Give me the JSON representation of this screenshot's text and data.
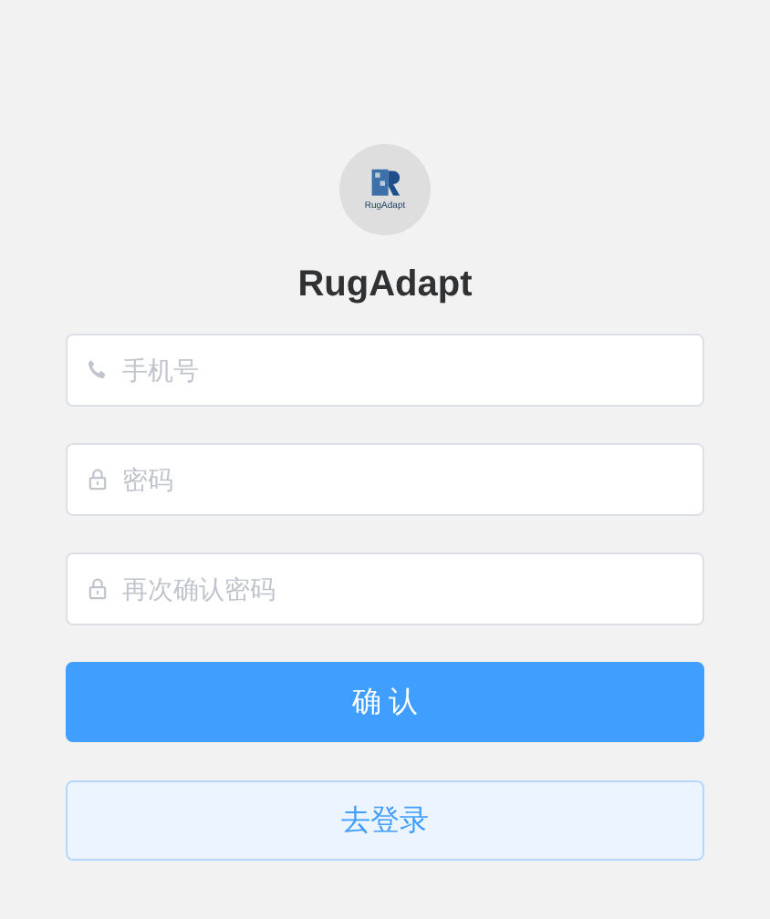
{
  "logo": {
    "caption": "RugAdapt"
  },
  "title": "RugAdapt",
  "fields": [
    {
      "kind": "phone",
      "placeholder": "手机号"
    },
    {
      "kind": "lock",
      "placeholder": "密码"
    },
    {
      "kind": "lock",
      "placeholder": "再次确认密码"
    }
  ],
  "confirm_button": "确 认",
  "login_button": "去登录"
}
